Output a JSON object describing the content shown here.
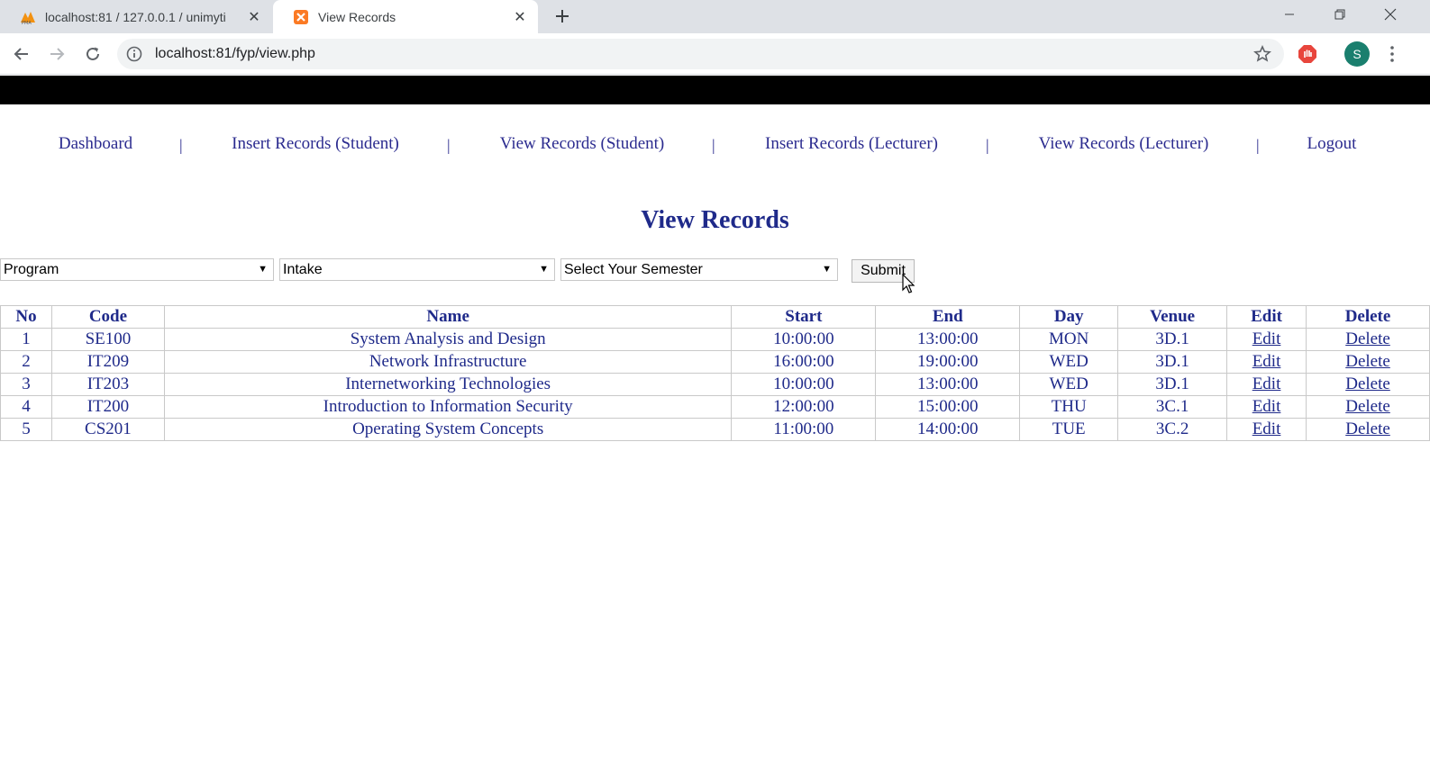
{
  "browser": {
    "tabs": [
      {
        "title": "localhost:81 / 127.0.0.1 / unimyti",
        "active": false,
        "icon": "phpmyadmin-icon"
      },
      {
        "title": "View Records",
        "active": true,
        "icon": "xampp-icon"
      }
    ],
    "url": "localhost:81/fyp/view.php",
    "avatar_letter": "S",
    "colors": {
      "tabstrip": "#dee1e6",
      "avatar": "#1a7f6e"
    }
  },
  "nav": {
    "items": [
      "Dashboard",
      "Insert Records (Student)",
      "View Records (Student)",
      "Insert Records (Lecturer)",
      "View Records (Lecturer)",
      "Logout"
    ],
    "separator": "|"
  },
  "page": {
    "title": "View Records",
    "filters": {
      "program": "Program",
      "intake": "Intake",
      "semester": "Select Your Semester",
      "submit_label": "Submit"
    },
    "colors": {
      "text": "#1f2a8a",
      "topbar": "#000000"
    }
  },
  "table": {
    "headers": [
      "No",
      "Code",
      "Name",
      "Start",
      "End",
      "Day",
      "Venue",
      "Edit",
      "Delete"
    ],
    "rows": [
      {
        "no": "1",
        "code": "SE100",
        "name": "System Analysis and Design",
        "start": "10:00:00",
        "end": "13:00:00",
        "day": "MON",
        "venue": "3D.1",
        "edit": "Edit",
        "delete": "Delete"
      },
      {
        "no": "2",
        "code": "IT209",
        "name": "Network Infrastructure",
        "start": "16:00:00",
        "end": "19:00:00",
        "day": "WED",
        "venue": "3D.1",
        "edit": "Edit",
        "delete": "Delete"
      },
      {
        "no": "3",
        "code": "IT203",
        "name": "Internetworking Technologies",
        "start": "10:00:00",
        "end": "13:00:00",
        "day": "WED",
        "venue": "3D.1",
        "edit": "Edit",
        "delete": "Delete"
      },
      {
        "no": "4",
        "code": "IT200",
        "name": "Introduction to Information Security",
        "start": "12:00:00",
        "end": "15:00:00",
        "day": "THU",
        "venue": "3C.1",
        "edit": "Edit",
        "delete": "Delete"
      },
      {
        "no": "5",
        "code": "CS201",
        "name": "Operating System Concepts",
        "start": "11:00:00",
        "end": "14:00:00",
        "day": "TUE",
        "venue": "3C.2",
        "edit": "Edit",
        "delete": "Delete"
      }
    ]
  }
}
